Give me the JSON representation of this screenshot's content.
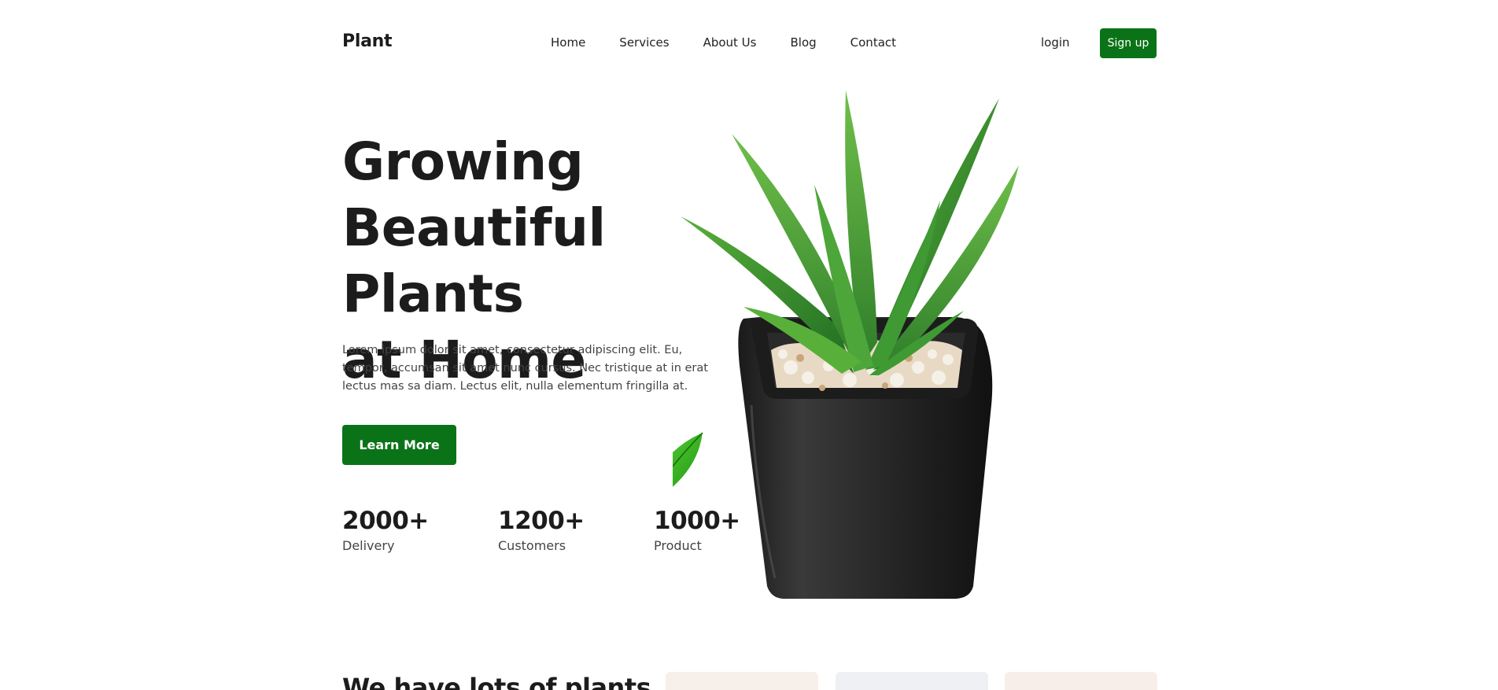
{
  "header": {
    "logo": "Plant",
    "nav": [
      "Home",
      "Services",
      "About Us",
      "Blog",
      "Contact"
    ],
    "login_label": "login",
    "signup_label": "Sign up"
  },
  "hero": {
    "title_lines": [
      "Growing",
      "Beautiful Plants",
      "at Home"
    ],
    "description": "Lorem ipsum dolor sit amet, consectetur adipiscing elit. Eu, tempor, accumsan sit amet nunc cursus. Nec tristique at in erat lectus mas sa diam. Lectus elit, nulla elementum fringilla at.",
    "cta_label": "Learn More",
    "stats": [
      {
        "value": "2000+",
        "label": "Delivery"
      },
      {
        "value": "1200+",
        "label": "Customers"
      },
      {
        "value": "1000+",
        "label": "Product"
      }
    ]
  },
  "section": {
    "title": "We have lots of plants"
  },
  "colors": {
    "brand_green": "#0b7317",
    "text_dark": "#1c1c1c"
  }
}
